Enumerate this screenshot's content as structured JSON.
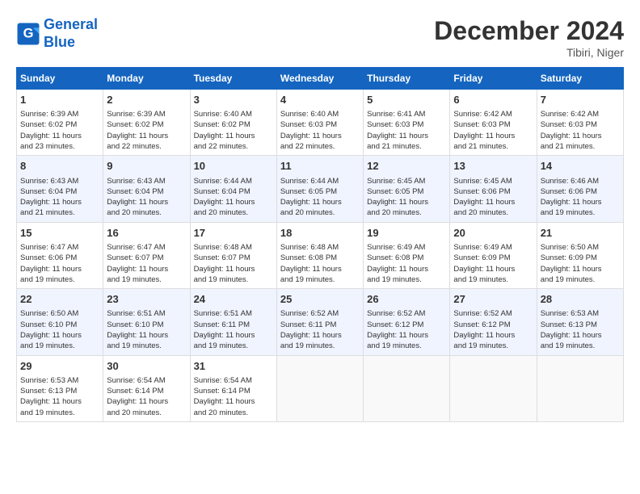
{
  "header": {
    "logo_line1": "General",
    "logo_line2": "Blue",
    "month": "December 2024",
    "location": "Tibiri, Niger"
  },
  "weekdays": [
    "Sunday",
    "Monday",
    "Tuesday",
    "Wednesday",
    "Thursday",
    "Friday",
    "Saturday"
  ],
  "weeks": [
    [
      {
        "day": "1",
        "sunrise": "6:39 AM",
        "sunset": "6:02 PM",
        "daylight": "11 hours and 23 minutes."
      },
      {
        "day": "2",
        "sunrise": "6:39 AM",
        "sunset": "6:02 PM",
        "daylight": "11 hours and 22 minutes."
      },
      {
        "day": "3",
        "sunrise": "6:40 AM",
        "sunset": "6:02 PM",
        "daylight": "11 hours and 22 minutes."
      },
      {
        "day": "4",
        "sunrise": "6:40 AM",
        "sunset": "6:03 PM",
        "daylight": "11 hours and 22 minutes."
      },
      {
        "day": "5",
        "sunrise": "6:41 AM",
        "sunset": "6:03 PM",
        "daylight": "11 hours and 21 minutes."
      },
      {
        "day": "6",
        "sunrise": "6:42 AM",
        "sunset": "6:03 PM",
        "daylight": "11 hours and 21 minutes."
      },
      {
        "day": "7",
        "sunrise": "6:42 AM",
        "sunset": "6:03 PM",
        "daylight": "11 hours and 21 minutes."
      }
    ],
    [
      {
        "day": "8",
        "sunrise": "6:43 AM",
        "sunset": "6:04 PM",
        "daylight": "11 hours and 21 minutes."
      },
      {
        "day": "9",
        "sunrise": "6:43 AM",
        "sunset": "6:04 PM",
        "daylight": "11 hours and 20 minutes."
      },
      {
        "day": "10",
        "sunrise": "6:44 AM",
        "sunset": "6:04 PM",
        "daylight": "11 hours and 20 minutes."
      },
      {
        "day": "11",
        "sunrise": "6:44 AM",
        "sunset": "6:05 PM",
        "daylight": "11 hours and 20 minutes."
      },
      {
        "day": "12",
        "sunrise": "6:45 AM",
        "sunset": "6:05 PM",
        "daylight": "11 hours and 20 minutes."
      },
      {
        "day": "13",
        "sunrise": "6:45 AM",
        "sunset": "6:06 PM",
        "daylight": "11 hours and 20 minutes."
      },
      {
        "day": "14",
        "sunrise": "6:46 AM",
        "sunset": "6:06 PM",
        "daylight": "11 hours and 19 minutes."
      }
    ],
    [
      {
        "day": "15",
        "sunrise": "6:47 AM",
        "sunset": "6:06 PM",
        "daylight": "11 hours and 19 minutes."
      },
      {
        "day": "16",
        "sunrise": "6:47 AM",
        "sunset": "6:07 PM",
        "daylight": "11 hours and 19 minutes."
      },
      {
        "day": "17",
        "sunrise": "6:48 AM",
        "sunset": "6:07 PM",
        "daylight": "11 hours and 19 minutes."
      },
      {
        "day": "18",
        "sunrise": "6:48 AM",
        "sunset": "6:08 PM",
        "daylight": "11 hours and 19 minutes."
      },
      {
        "day": "19",
        "sunrise": "6:49 AM",
        "sunset": "6:08 PM",
        "daylight": "11 hours and 19 minutes."
      },
      {
        "day": "20",
        "sunrise": "6:49 AM",
        "sunset": "6:09 PM",
        "daylight": "11 hours and 19 minutes."
      },
      {
        "day": "21",
        "sunrise": "6:50 AM",
        "sunset": "6:09 PM",
        "daylight": "11 hours and 19 minutes."
      }
    ],
    [
      {
        "day": "22",
        "sunrise": "6:50 AM",
        "sunset": "6:10 PM",
        "daylight": "11 hours and 19 minutes."
      },
      {
        "day": "23",
        "sunrise": "6:51 AM",
        "sunset": "6:10 PM",
        "daylight": "11 hours and 19 minutes."
      },
      {
        "day": "24",
        "sunrise": "6:51 AM",
        "sunset": "6:11 PM",
        "daylight": "11 hours and 19 minutes."
      },
      {
        "day": "25",
        "sunrise": "6:52 AM",
        "sunset": "6:11 PM",
        "daylight": "11 hours and 19 minutes."
      },
      {
        "day": "26",
        "sunrise": "6:52 AM",
        "sunset": "6:12 PM",
        "daylight": "11 hours and 19 minutes."
      },
      {
        "day": "27",
        "sunrise": "6:52 AM",
        "sunset": "6:12 PM",
        "daylight": "11 hours and 19 minutes."
      },
      {
        "day": "28",
        "sunrise": "6:53 AM",
        "sunset": "6:13 PM",
        "daylight": "11 hours and 19 minutes."
      }
    ],
    [
      {
        "day": "29",
        "sunrise": "6:53 AM",
        "sunset": "6:13 PM",
        "daylight": "11 hours and 19 minutes."
      },
      {
        "day": "30",
        "sunrise": "6:54 AM",
        "sunset": "6:14 PM",
        "daylight": "11 hours and 20 minutes."
      },
      {
        "day": "31",
        "sunrise": "6:54 AM",
        "sunset": "6:14 PM",
        "daylight": "11 hours and 20 minutes."
      },
      null,
      null,
      null,
      null
    ]
  ]
}
